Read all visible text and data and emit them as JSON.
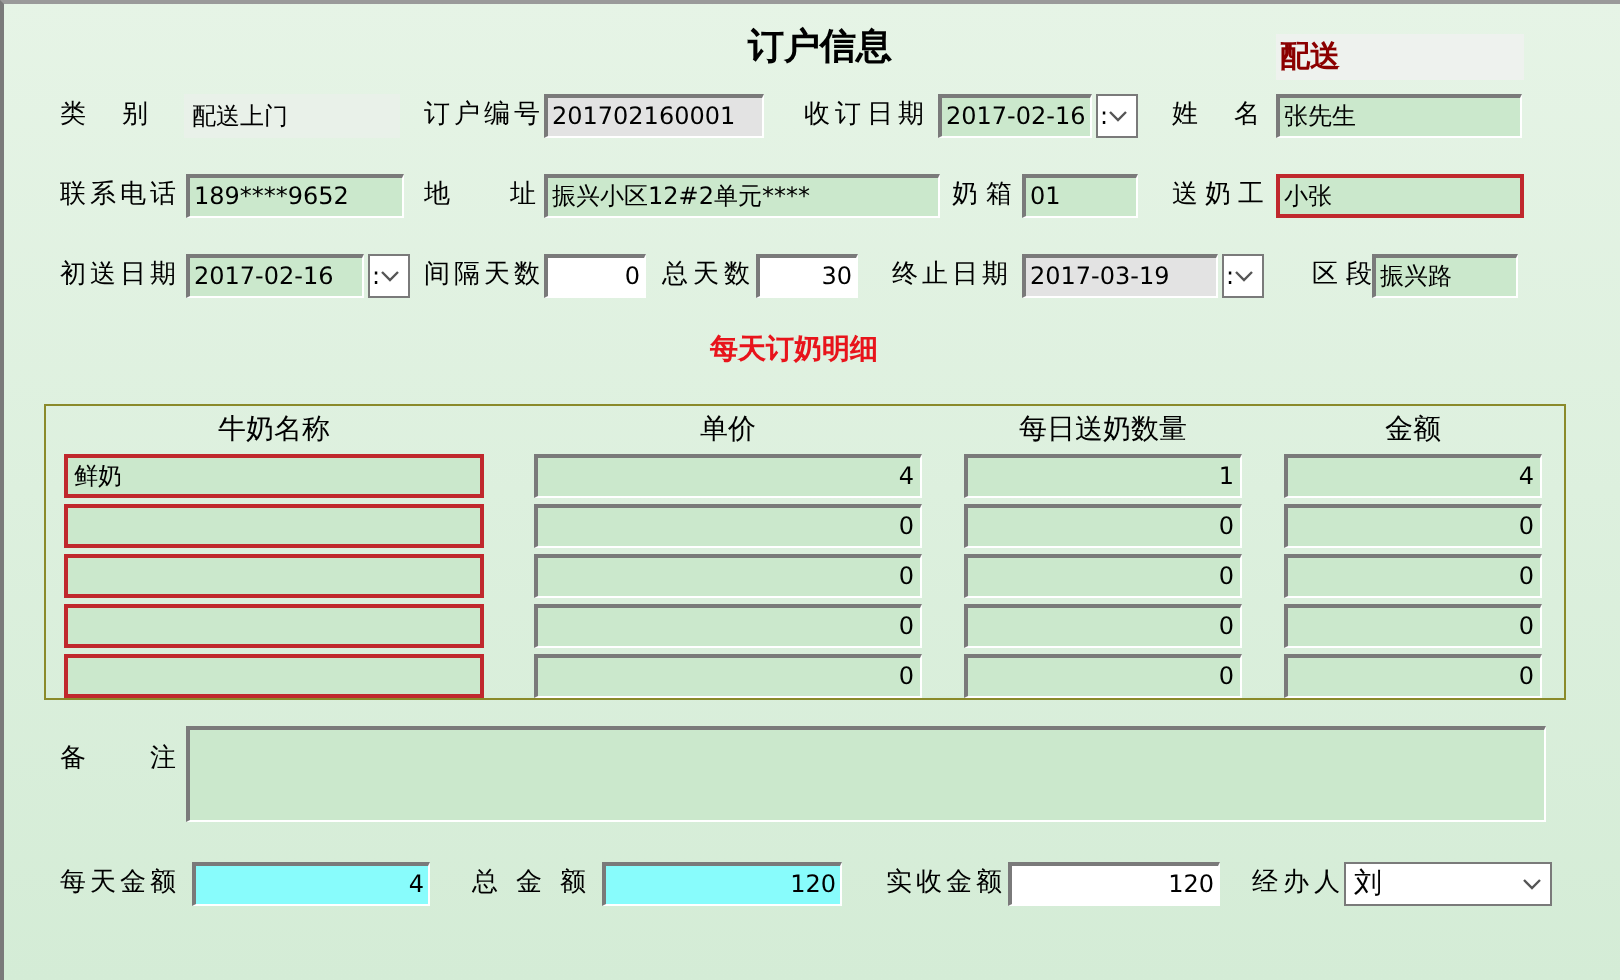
{
  "window": {
    "title": "订户信息"
  },
  "mode_badge": "配送",
  "header_rows": [
    [
      {
        "label": "类 别",
        "value": "配送上门",
        "kind": "text",
        "color": "#e9f1e9",
        "flagged": false
      },
      {
        "label": "订户编号",
        "value": "201702160001",
        "kind": "text",
        "color": "#e3e3e3",
        "flagged": false
      },
      {
        "label": "收订日期",
        "value": "2017-02-16",
        "kind": "date",
        "color": "#cbe8cc",
        "flagged": false,
        "button_text": ":"
      },
      {
        "label": "姓 名",
        "value": "张先生",
        "kind": "text",
        "color": "#cbe8cc",
        "flagged": false
      }
    ],
    [
      {
        "label": "联系电话",
        "value": "189****9652",
        "kind": "text",
        "color": "#cbe8cc",
        "flagged": false
      },
      {
        "label": "地 址",
        "value": "振兴小区12#2单元****",
        "kind": "text",
        "color": "#cbe8cc",
        "flagged": false
      },
      {
        "label": "奶箱",
        "value": "01",
        "kind": "text",
        "color": "#cbe8cc",
        "flagged": false
      },
      {
        "label": "送奶工",
        "value": "小张",
        "kind": "text",
        "color": "#cbe8cc",
        "flagged": true
      }
    ],
    [
      {
        "label": "初送日期",
        "value": "2017-02-16",
        "kind": "date",
        "color": "#cbe8cc",
        "flagged": false,
        "button_text": ":"
      },
      {
        "label": "间隔天数",
        "value": "0",
        "kind": "number",
        "color": "#ffffff",
        "flagged": false
      },
      {
        "label": "总天数",
        "value": "30",
        "kind": "number",
        "color": "#ffffff",
        "flagged": false
      },
      {
        "label": "终止日期",
        "value": "2017-03-19",
        "kind": "date",
        "color": "#e3e3e3",
        "flagged": false,
        "button_text": ":"
      },
      {
        "label": "区段",
        "value": "振兴路",
        "kind": "text",
        "color": "#cbe8cc",
        "flagged": false
      }
    ]
  ],
  "detail_title": "每天订奶明细",
  "table": {
    "columns": [
      {
        "title": "牛奶名称",
        "flagged": true
      },
      {
        "title": "单价",
        "flagged": false
      },
      {
        "title": "每日送奶数量",
        "flagged": false
      },
      {
        "title": "金额",
        "flagged": false
      }
    ],
    "rows": [
      {
        "milk_name": "鲜奶",
        "unit_price": "4",
        "daily_quantity": "1",
        "amount": "4"
      },
      {
        "unit_price": "0",
        "daily_quantity": "0",
        "amount": "0"
      },
      {
        "unit_price": "0",
        "daily_quantity": "0",
        "amount": "0"
      },
      {
        "unit_price": "0",
        "daily_quantity": "0",
        "amount": "0"
      },
      {
        "unit_price": "0",
        "daily_quantity": "0",
        "amount": "0"
      }
    ]
  },
  "remarks": {
    "label": "备 注"
  },
  "totals": [
    {
      "label": "每天金额",
      "value": "4",
      "kind": "number",
      "color": "#88fcfc",
      "flagged": false
    },
    {
      "label": "总 金 额",
      "value": "120",
      "kind": "number",
      "color": "#88fcfc",
      "flagged": false
    },
    {
      "label": "实收金额",
      "value": "120",
      "kind": "number",
      "color": "#ffffff",
      "flagged": false
    },
    {
      "label": "经办人",
      "value": "刘",
      "kind": "select",
      "color": "#ffffff",
      "flagged": false
    }
  ]
}
